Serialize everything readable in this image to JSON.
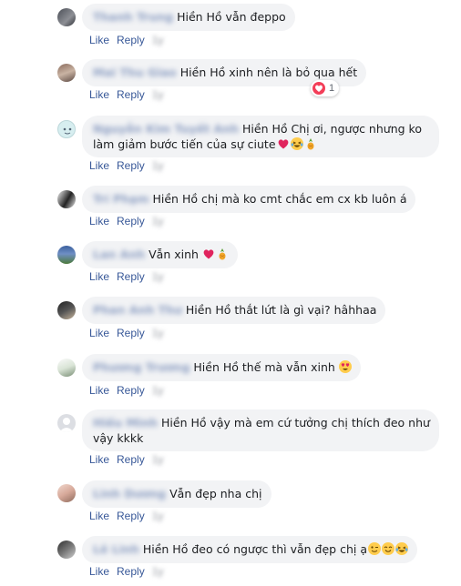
{
  "comments": [
    {
      "author": "Thanh Trung",
      "text": "Hiền Hồ vẫn đeppo",
      "like": "Like",
      "reply": "Reply",
      "time": "1y",
      "emojis": []
    },
    {
      "author": "Mai Thu Giao",
      "text": "Hiền Hồ xinh nên là bỏ qua hết",
      "like": "Like",
      "reply": "Reply",
      "time": "1y",
      "emojis": [],
      "reaction_count": "1"
    },
    {
      "author": "Nguyễn Kim Tuyết Anh",
      "text": "Hiền Hồ Chị ơi, ngược nhưng ko làm giảm bước tiến của sự ciute",
      "like": "Like",
      "reply": "Reply",
      "time": "1y",
      "emojis": [
        "heart",
        "laugh",
        "pineapple"
      ]
    },
    {
      "author": "Trí Phạm",
      "text": "Hiền Hồ chị mà ko cmt chắc em cx kb luôn á",
      "like": "Like",
      "reply": "Reply",
      "time": "1y",
      "emojis": []
    },
    {
      "author": "Lan Anh",
      "text": "Vẫn xinh",
      "like": "Like",
      "reply": "Reply",
      "time": "1y",
      "emojis": [
        "heart",
        "pineapple"
      ]
    },
    {
      "author": "Phan Anh Thư",
      "text": "Hiền Hồ thắt lứt là gì vại? hâhhaa",
      "like": "Like",
      "reply": "Reply",
      "time": "1y",
      "emojis": []
    },
    {
      "author": "Phương Trương",
      "text": "Hiền Hồ thế mà vẫn xinh",
      "like": "Like",
      "reply": "Reply",
      "time": "1y",
      "emojis": [
        "heart-eyes"
      ]
    },
    {
      "author": "Hiếu Minh",
      "text": "Hiền Hồ vậy mà em cứ tưởng chị thích đeo như vậy kkkk",
      "like": "Like",
      "reply": "Reply",
      "time": "1y",
      "emojis": []
    },
    {
      "author": "Linh Dương",
      "text": "Vẫn đẹp nha chị",
      "like": "Like",
      "reply": "Reply",
      "time": "1y",
      "emojis": []
    },
    {
      "author": "Lê Linh",
      "text": "Hiền Hồ đeo có ngược thì vẫn đẹp chị ạ",
      "like": "Like",
      "reply": "Reply",
      "time": "1y",
      "emojis": [
        "wink",
        "smile",
        "laugh"
      ]
    }
  ],
  "colors": {
    "link": "#385898",
    "bubble": "#f2f3f5",
    "reaction_heart": "#f33e58"
  }
}
